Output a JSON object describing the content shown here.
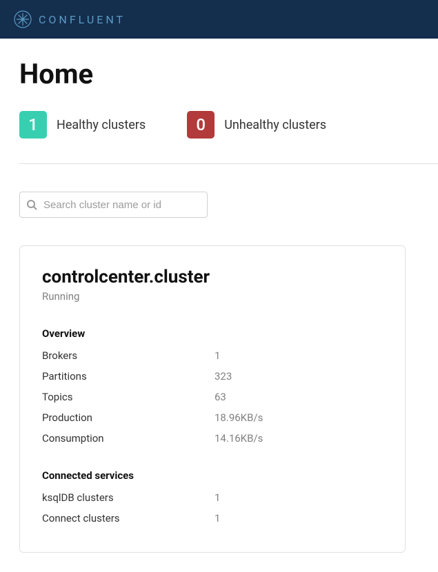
{
  "header": {
    "brand": "CONFLUENT"
  },
  "page": {
    "title": "Home"
  },
  "status": {
    "healthy": {
      "count": "1",
      "label": "Healthy clusters"
    },
    "unhealthy": {
      "count": "0",
      "label": "Unhealthy clusters"
    }
  },
  "search": {
    "placeholder": "Search cluster name or id"
  },
  "cluster": {
    "name": "controlcenter.cluster",
    "status": "Running",
    "overview_title": "Overview",
    "overview": {
      "brokers": {
        "label": "Brokers",
        "value": "1"
      },
      "partitions": {
        "label": "Partitions",
        "value": "323"
      },
      "topics": {
        "label": "Topics",
        "value": "63"
      },
      "production": {
        "label": "Production",
        "value": "18.96KB/s"
      },
      "consumption": {
        "label": "Consumption",
        "value": "14.16KB/s"
      }
    },
    "services_title": "Connected services",
    "services": {
      "ksqldb": {
        "label": "ksqlDB clusters",
        "value": "1"
      },
      "connect": {
        "label": "Connect clusters",
        "value": "1"
      }
    }
  }
}
